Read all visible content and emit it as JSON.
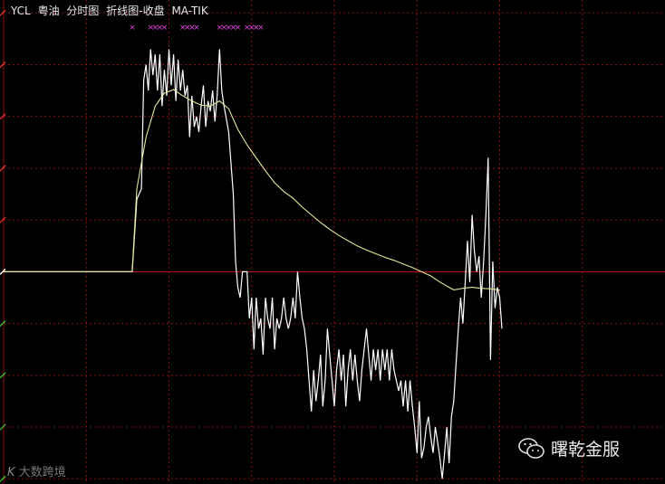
{
  "header": {
    "symbol": "YCL",
    "name": "粤油",
    "view": "分时图",
    "mode": "折线图-收盘",
    "indicator": "MA-TIK"
  },
  "watermarks": {
    "left": "大数跨境",
    "right": "曙乾金服",
    "right_icon": "wechat-icon",
    "left_icon": "k-logo-icon"
  },
  "colors": {
    "background": "#000000",
    "grid": "#8a1010",
    "baseline": "#c81818",
    "price_line": "#ffffff",
    "ma_line": "#e6e69a",
    "marker": "#e040e0",
    "up_tick": "#e03030",
    "down_tick": "#30c030",
    "flat_tick": "#ffffff"
  },
  "chart_data": {
    "type": "line",
    "title": "YCL 粤油 分时图 折线图-收盘 MA-TIK",
    "baseline": 0,
    "ylim": [
      -4.1,
      5.25
    ],
    "grid_levels": [
      5,
      4,
      3,
      2,
      1,
      0,
      -1,
      -2,
      -3,
      -4
    ],
    "xlim": [
      0,
      144
    ],
    "series": [
      {
        "name": "收盘",
        "points": [
          [
            0,
            0
          ],
          [
            20,
            0
          ],
          [
            28,
            0
          ],
          [
            29,
            1.4
          ],
          [
            30,
            1.6
          ],
          [
            30.5,
            3.7
          ],
          [
            31,
            4.0
          ],
          [
            31.5,
            3.5
          ],
          [
            32,
            4.3
          ],
          [
            32.5,
            3.8
          ],
          [
            33,
            4.2
          ],
          [
            33.5,
            3.5
          ],
          [
            34,
            4.2
          ],
          [
            34.5,
            3.2
          ],
          [
            35,
            3.9
          ],
          [
            35.5,
            3.4
          ],
          [
            36,
            4.3
          ],
          [
            36.5,
            3.6
          ],
          [
            37,
            4.2
          ],
          [
            37.5,
            3.3
          ],
          [
            38,
            4.1
          ],
          [
            38.5,
            3.5
          ],
          [
            39,
            3.9
          ],
          [
            39.5,
            3.4
          ],
          [
            40,
            3.6
          ],
          [
            40.5,
            2.6
          ],
          [
            41,
            3.4
          ],
          [
            41.5,
            2.8
          ],
          [
            42,
            3.0
          ],
          [
            42.5,
            2.7
          ],
          [
            43,
            3.2
          ],
          [
            43.5,
            3.6
          ],
          [
            44,
            2.8
          ],
          [
            44.5,
            3.3
          ],
          [
            45,
            3.1
          ],
          [
            45.5,
            3.5
          ],
          [
            46,
            2.9
          ],
          [
            46.5,
            3.4
          ],
          [
            47,
            4.3
          ],
          [
            47.5,
            3.5
          ],
          [
            48,
            3.2
          ],
          [
            49,
            2.7
          ],
          [
            50,
            1.5
          ],
          [
            50.5,
            0.2
          ],
          [
            51,
            -0.3
          ],
          [
            51.5,
            -0.5
          ],
          [
            52,
            0
          ],
          [
            53,
            0
          ],
          [
            53.5,
            -0.9
          ],
          [
            54,
            -0.5
          ],
          [
            54.5,
            -1.5
          ],
          [
            55,
            -0.5
          ],
          [
            55.5,
            -1.1
          ],
          [
            56,
            -0.9
          ],
          [
            56.5,
            -1.6
          ],
          [
            57,
            -0.5
          ],
          [
            57.5,
            -0.9
          ],
          [
            58,
            -1.1
          ],
          [
            58.5,
            -0.5
          ],
          [
            59,
            -1.5
          ],
          [
            59.5,
            -0.9
          ],
          [
            60,
            -1.1
          ],
          [
            60.5,
            -0.9
          ],
          [
            61,
            -0.5
          ],
          [
            61.5,
            -0.9
          ],
          [
            62,
            -1.1
          ],
          [
            62.5,
            -0.9
          ],
          [
            63,
            -0.5
          ],
          [
            63.5,
            -0.9
          ],
          [
            64,
            0
          ],
          [
            64.5,
            -0.5
          ],
          [
            65,
            -0.9
          ],
          [
            65.5,
            -1.1
          ],
          [
            66,
            -1.5
          ],
          [
            66.5,
            -2.1
          ],
          [
            67,
            -2.7
          ],
          [
            67.5,
            -1.9
          ],
          [
            68,
            -2.5
          ],
          [
            68.5,
            -2.1
          ],
          [
            69,
            -1.6
          ],
          [
            69.5,
            -2.6
          ],
          [
            70,
            -2.1
          ],
          [
            70.5,
            -1.1
          ],
          [
            71,
            -1.6
          ],
          [
            71.5,
            -2.1
          ],
          [
            72,
            -2.6
          ],
          [
            72.5,
            -1.9
          ],
          [
            73,
            -1.5
          ],
          [
            73.5,
            -2.1
          ],
          [
            74,
            -1.6
          ],
          [
            74.5,
            -2.6
          ],
          [
            75,
            -1.9
          ],
          [
            75.5,
            -1.5
          ],
          [
            76,
            -2.1
          ],
          [
            76.5,
            -1.6
          ],
          [
            77,
            -2.1
          ],
          [
            77.5,
            -2.5
          ],
          [
            78,
            -1.9
          ],
          [
            78.5,
            -1.5
          ],
          [
            79,
            -1.1
          ],
          [
            79.5,
            -1.6
          ],
          [
            80,
            -2.1
          ],
          [
            80.5,
            -1.5
          ],
          [
            81,
            -1.9
          ],
          [
            81.5,
            -1.5
          ],
          [
            82,
            -2.1
          ],
          [
            82.5,
            -1.5
          ],
          [
            83,
            -1.9
          ],
          [
            83.5,
            -1.5
          ],
          [
            84,
            -2.1
          ],
          [
            84.5,
            -1.5
          ],
          [
            85,
            -1.9
          ],
          [
            86,
            -2.3
          ],
          [
            86.5,
            -2.1
          ],
          [
            87,
            -2.6
          ],
          [
            87.5,
            -2.1
          ],
          [
            88,
            -2.7
          ],
          [
            88.5,
            -2.1
          ],
          [
            89,
            -2.6
          ],
          [
            89.5,
            -3.0
          ],
          [
            90,
            -3.5
          ],
          [
            90.5,
            -2.5
          ],
          [
            91,
            -3.6
          ],
          [
            91.5,
            -3.4
          ],
          [
            92,
            -3.0
          ],
          [
            92.5,
            -2.8
          ],
          [
            93,
            -3.2
          ],
          [
            93.5,
            -3.5
          ],
          [
            94,
            -3.0
          ],
          [
            94.5,
            -3.3
          ],
          [
            95,
            -3.6
          ],
          [
            95.5,
            -4.0
          ],
          [
            96,
            -3.5
          ],
          [
            96.5,
            -3.0
          ],
          [
            97,
            -3.7
          ],
          [
            97.5,
            -2.8
          ],
          [
            98,
            -2.5
          ],
          [
            98.5,
            -1.8
          ],
          [
            99,
            -1.1
          ],
          [
            99.5,
            -0.5
          ],
          [
            100,
            -1.0
          ],
          [
            100.5,
            -0.2
          ],
          [
            101,
            0.6
          ],
          [
            101.5,
            -0.2
          ],
          [
            102,
            1.1
          ],
          [
            102.5,
            0.4
          ],
          [
            103,
            0
          ],
          [
            103.5,
            0.3
          ],
          [
            104,
            -0.5
          ],
          [
            104.5,
            0.2
          ],
          [
            105,
            1.1
          ],
          [
            105.5,
            2.2
          ],
          [
            106,
            -1.7
          ],
          [
            106.5,
            0.2
          ],
          [
            107,
            -0.7
          ],
          [
            107.5,
            -0.3
          ],
          [
            108,
            -0.5
          ],
          [
            108.5,
            -1.1
          ]
        ]
      },
      {
        "name": "MA-TIK",
        "points": [
          [
            0,
            0
          ],
          [
            28,
            0
          ],
          [
            29,
            1.6
          ],
          [
            31,
            2.6
          ],
          [
            33,
            3.2
          ],
          [
            35,
            3.45
          ],
          [
            37,
            3.52
          ],
          [
            39,
            3.4
          ],
          [
            41,
            3.3
          ],
          [
            43,
            3.22
          ],
          [
            45,
            3.2
          ],
          [
            47,
            3.3
          ],
          [
            49,
            3.15
          ],
          [
            51,
            2.75
          ],
          [
            53,
            2.45
          ],
          [
            55,
            2.2
          ],
          [
            57,
            1.95
          ],
          [
            59,
            1.72
          ],
          [
            61,
            1.55
          ],
          [
            63,
            1.42
          ],
          [
            65,
            1.25
          ],
          [
            67,
            1.1
          ],
          [
            69,
            0.95
          ],
          [
            71,
            0.82
          ],
          [
            73,
            0.7
          ],
          [
            75,
            0.6
          ],
          [
            77,
            0.5
          ],
          [
            79,
            0.42
          ],
          [
            81,
            0.35
          ],
          [
            83,
            0.28
          ],
          [
            85,
            0.22
          ],
          [
            87,
            0.15
          ],
          [
            89,
            0.08
          ],
          [
            91,
            0
          ],
          [
            93,
            -0.08
          ],
          [
            95,
            -0.2
          ],
          [
            97,
            -0.3
          ],
          [
            98,
            -0.35
          ],
          [
            100,
            -0.32
          ],
          [
            102,
            -0.3
          ],
          [
            104,
            -0.32
          ],
          [
            106,
            -0.33
          ],
          [
            108,
            -0.35
          ]
        ]
      }
    ],
    "markers": {
      "symbol": "×",
      "x": [
        28,
        32,
        33,
        34,
        35,
        39,
        40,
        41,
        42,
        47,
        48,
        49,
        50,
        51,
        53,
        54,
        55,
        56
      ]
    },
    "axis_ticks": [
      {
        "level": 5,
        "dir": "up"
      },
      {
        "level": 4,
        "dir": "up"
      },
      {
        "level": 3,
        "dir": "up"
      },
      {
        "level": 2,
        "dir": "up"
      },
      {
        "level": 1,
        "dir": "up"
      },
      {
        "level": 0,
        "dir": "flat"
      },
      {
        "level": -1,
        "dir": "down"
      },
      {
        "level": -2,
        "dir": "down"
      },
      {
        "level": -3,
        "dir": "down"
      },
      {
        "level": -4,
        "dir": "down"
      }
    ],
    "grid": true,
    "legend": "none"
  }
}
